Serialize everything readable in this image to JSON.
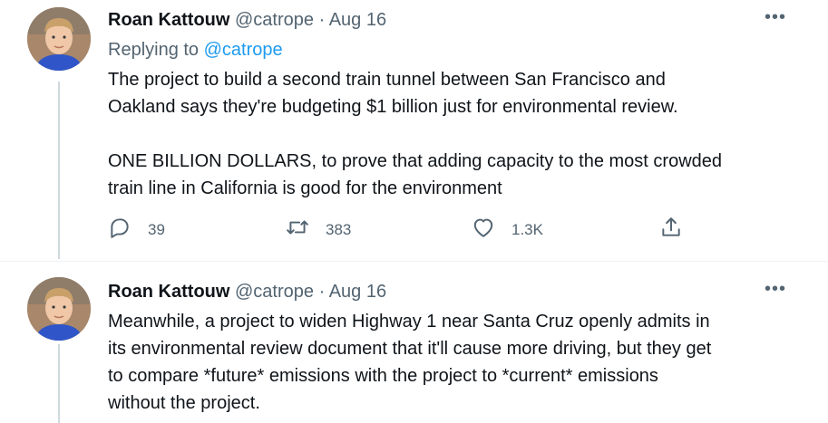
{
  "tweets": [
    {
      "author_name": "Roan Kattouw",
      "handle": "@catrope",
      "separator": "·",
      "date": "Aug 16",
      "replying_to_label": "Replying to",
      "replying_to_handle": "@catrope",
      "text": "The project to build a second train tunnel between San Francisco and\nOakland says they're budgeting $1 billion just for environmental review.\n\nONE BILLION DOLLARS, to prove that adding capacity to the most crowded\ntrain line in California is good for the environment",
      "more_label": "•••",
      "actions": {
        "reply_icon": "reply-icon",
        "reply_count": "39",
        "retweet_icon": "retweet-icon",
        "retweet_count": "383",
        "like_icon": "heart-icon",
        "like_count": "1.3K",
        "share_icon": "share-icon"
      }
    },
    {
      "author_name": "Roan Kattouw",
      "handle": "@catrope",
      "separator": "·",
      "date": "Aug 16",
      "text": "Meanwhile, a project to widen Highway 1 near Santa Cruz openly admits in\nits environmental review document that it'll cause more driving, but they get\nto compare *future* emissions with the project to *current* emissions\nwithout the project.",
      "more_label": "•••"
    }
  ],
  "colors": {
    "text": "#0f1419",
    "secondary": "#536471",
    "link": "#1d9bf0",
    "thread_line": "#cfd9de"
  }
}
